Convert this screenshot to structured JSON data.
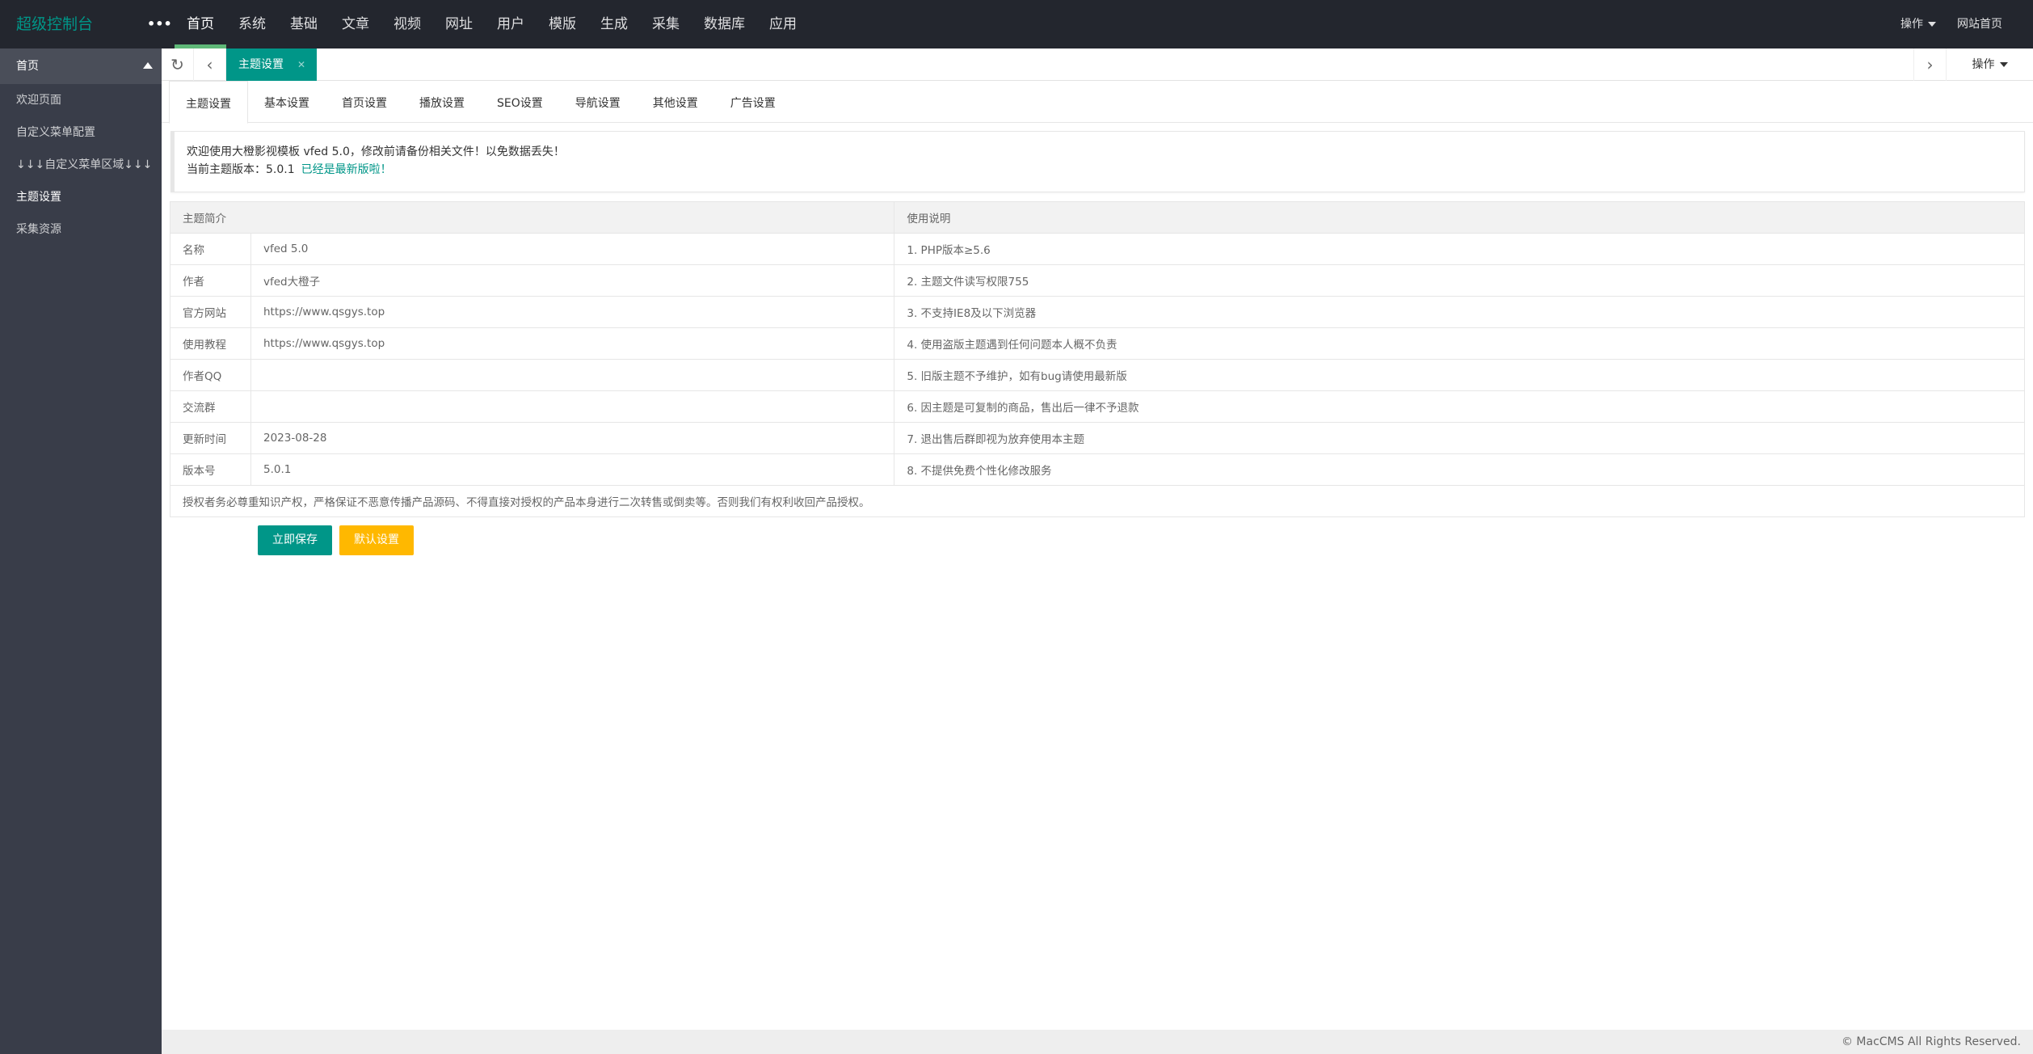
{
  "header": {
    "logo": "超级控制台",
    "more": "•••",
    "nav": [
      "首页",
      "系统",
      "基础",
      "文章",
      "视频",
      "网址",
      "用户",
      "模版",
      "生成",
      "采集",
      "数据库",
      "应用"
    ],
    "active_nav": 0,
    "operate": "操作",
    "site_home": "网站首页"
  },
  "sidebar": {
    "group": "首页",
    "items": [
      "欢迎页面",
      "自定义菜单配置",
      "↓↓↓自定义菜单区域↓↓↓",
      "主题设置",
      "采集资源"
    ],
    "active": 3
  },
  "tabbar": {
    "active_tab": "主题设置",
    "close": "✕",
    "operate": "操作"
  },
  "subtabs": [
    "主题设置",
    "基本设置",
    "首页设置",
    "播放设置",
    "SEO设置",
    "导航设置",
    "其他设置",
    "广告设置"
  ],
  "alert": {
    "line1": "欢迎使用大橙影视模板 vfed 5.0，修改前请备份相关文件！以免数据丢失！",
    "line2": "当前主题版本：5.0.1",
    "status": "已经是最新版啦！"
  },
  "table": {
    "headers": [
      "主题简介",
      "使用说明"
    ],
    "rows": [
      {
        "label": "名称",
        "value": "vfed 5.0",
        "note": "1. PHP版本≥5.6"
      },
      {
        "label": "作者",
        "value": "vfed大橙子",
        "note": "2. 主题文件读写权限755"
      },
      {
        "label": "官方网站",
        "value": "https://www.qsgys.top",
        "note": "3. 不支持IE8及以下浏览器"
      },
      {
        "label": "使用教程",
        "value": "https://www.qsgys.top",
        "note": "4. 使用盗版主题遇到任何问题本人概不负责"
      },
      {
        "label": "作者QQ",
        "value": "",
        "note": "5. 旧版主题不予维护，如有bug请使用最新版"
      },
      {
        "label": "交流群",
        "value": "",
        "note": "6. 因主题是可复制的商品，售出后一律不予退款"
      },
      {
        "label": "更新时间",
        "value": "2023-08-28",
        "note": "7. 退出售后群即视为放弃使用本主题"
      },
      {
        "label": "版本号",
        "value": "5.0.1",
        "note": "8. 不提供免费个性化修改服务"
      }
    ],
    "footer": "授权者务必尊重知识产权，严格保证不恶意传播产品源码、不得直接对授权的产品本身进行二次转售或倒卖等。否则我们有权利收回产品授权。"
  },
  "buttons": {
    "save": "立即保存",
    "default": "默认设置"
  },
  "colors": {
    "primary": "#009688",
    "warning": "#ffb800",
    "header_bg": "#23262e",
    "sidebar_bg": "#393d49",
    "nav_indicator": "#5fb878"
  },
  "footer": "© MacCMS All Rights Reserved."
}
